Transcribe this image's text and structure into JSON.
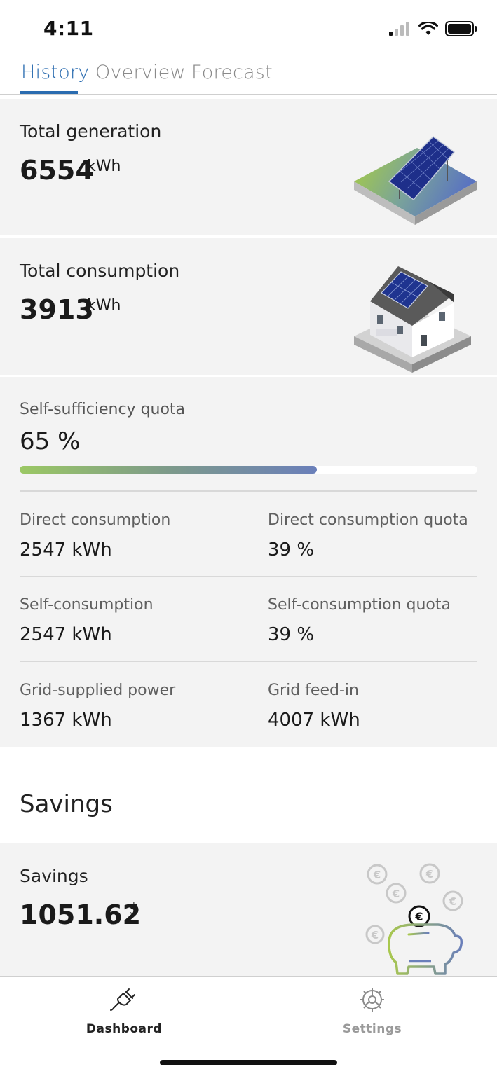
{
  "status_bar": {
    "time": "4:11"
  },
  "tabs": [
    {
      "label": "History",
      "active": true
    },
    {
      "label": "Overview",
      "active": false
    },
    {
      "label": "Forecast",
      "active": false
    }
  ],
  "generation": {
    "label": "Total generation",
    "value": "6554",
    "unit": "kWh",
    "icon": "solar-panel-illustration"
  },
  "consumption": {
    "label": "Total consumption",
    "value": "3913",
    "unit": "kWh",
    "icon": "house-illustration"
  },
  "self_sufficiency": {
    "label": "Self-sufficiency quota",
    "value": "65 %",
    "progress_percent": 65
  },
  "stats": [
    {
      "label": "Direct consumption",
      "value": "2547 kWh"
    },
    {
      "label": "Direct consumption quota",
      "value": "39 %"
    },
    {
      "label": "Self-consumption",
      "value": "2547 kWh"
    },
    {
      "label": "Self-consumption quota",
      "value": "39 %"
    },
    {
      "label": "Grid-supplied power",
      "value": "1367 kWh"
    },
    {
      "label": "Grid feed-in",
      "value": "4007 kWh"
    }
  ],
  "savings_section": {
    "title": "Savings"
  },
  "savings": {
    "label": "Savings",
    "value": "1051.62",
    "unit": "$",
    "icon": "piggy-bank-illustration"
  },
  "bottom_nav": [
    {
      "label": "Dashboard",
      "icon": "plug-icon",
      "active": true
    },
    {
      "label": "Settings",
      "icon": "gear-icon",
      "active": false
    }
  ],
  "colors": {
    "accent": "#2b6cb0",
    "card_bg": "#f3f3f3",
    "progress_start": "#9bc864",
    "progress_end": "#6a7fba"
  }
}
